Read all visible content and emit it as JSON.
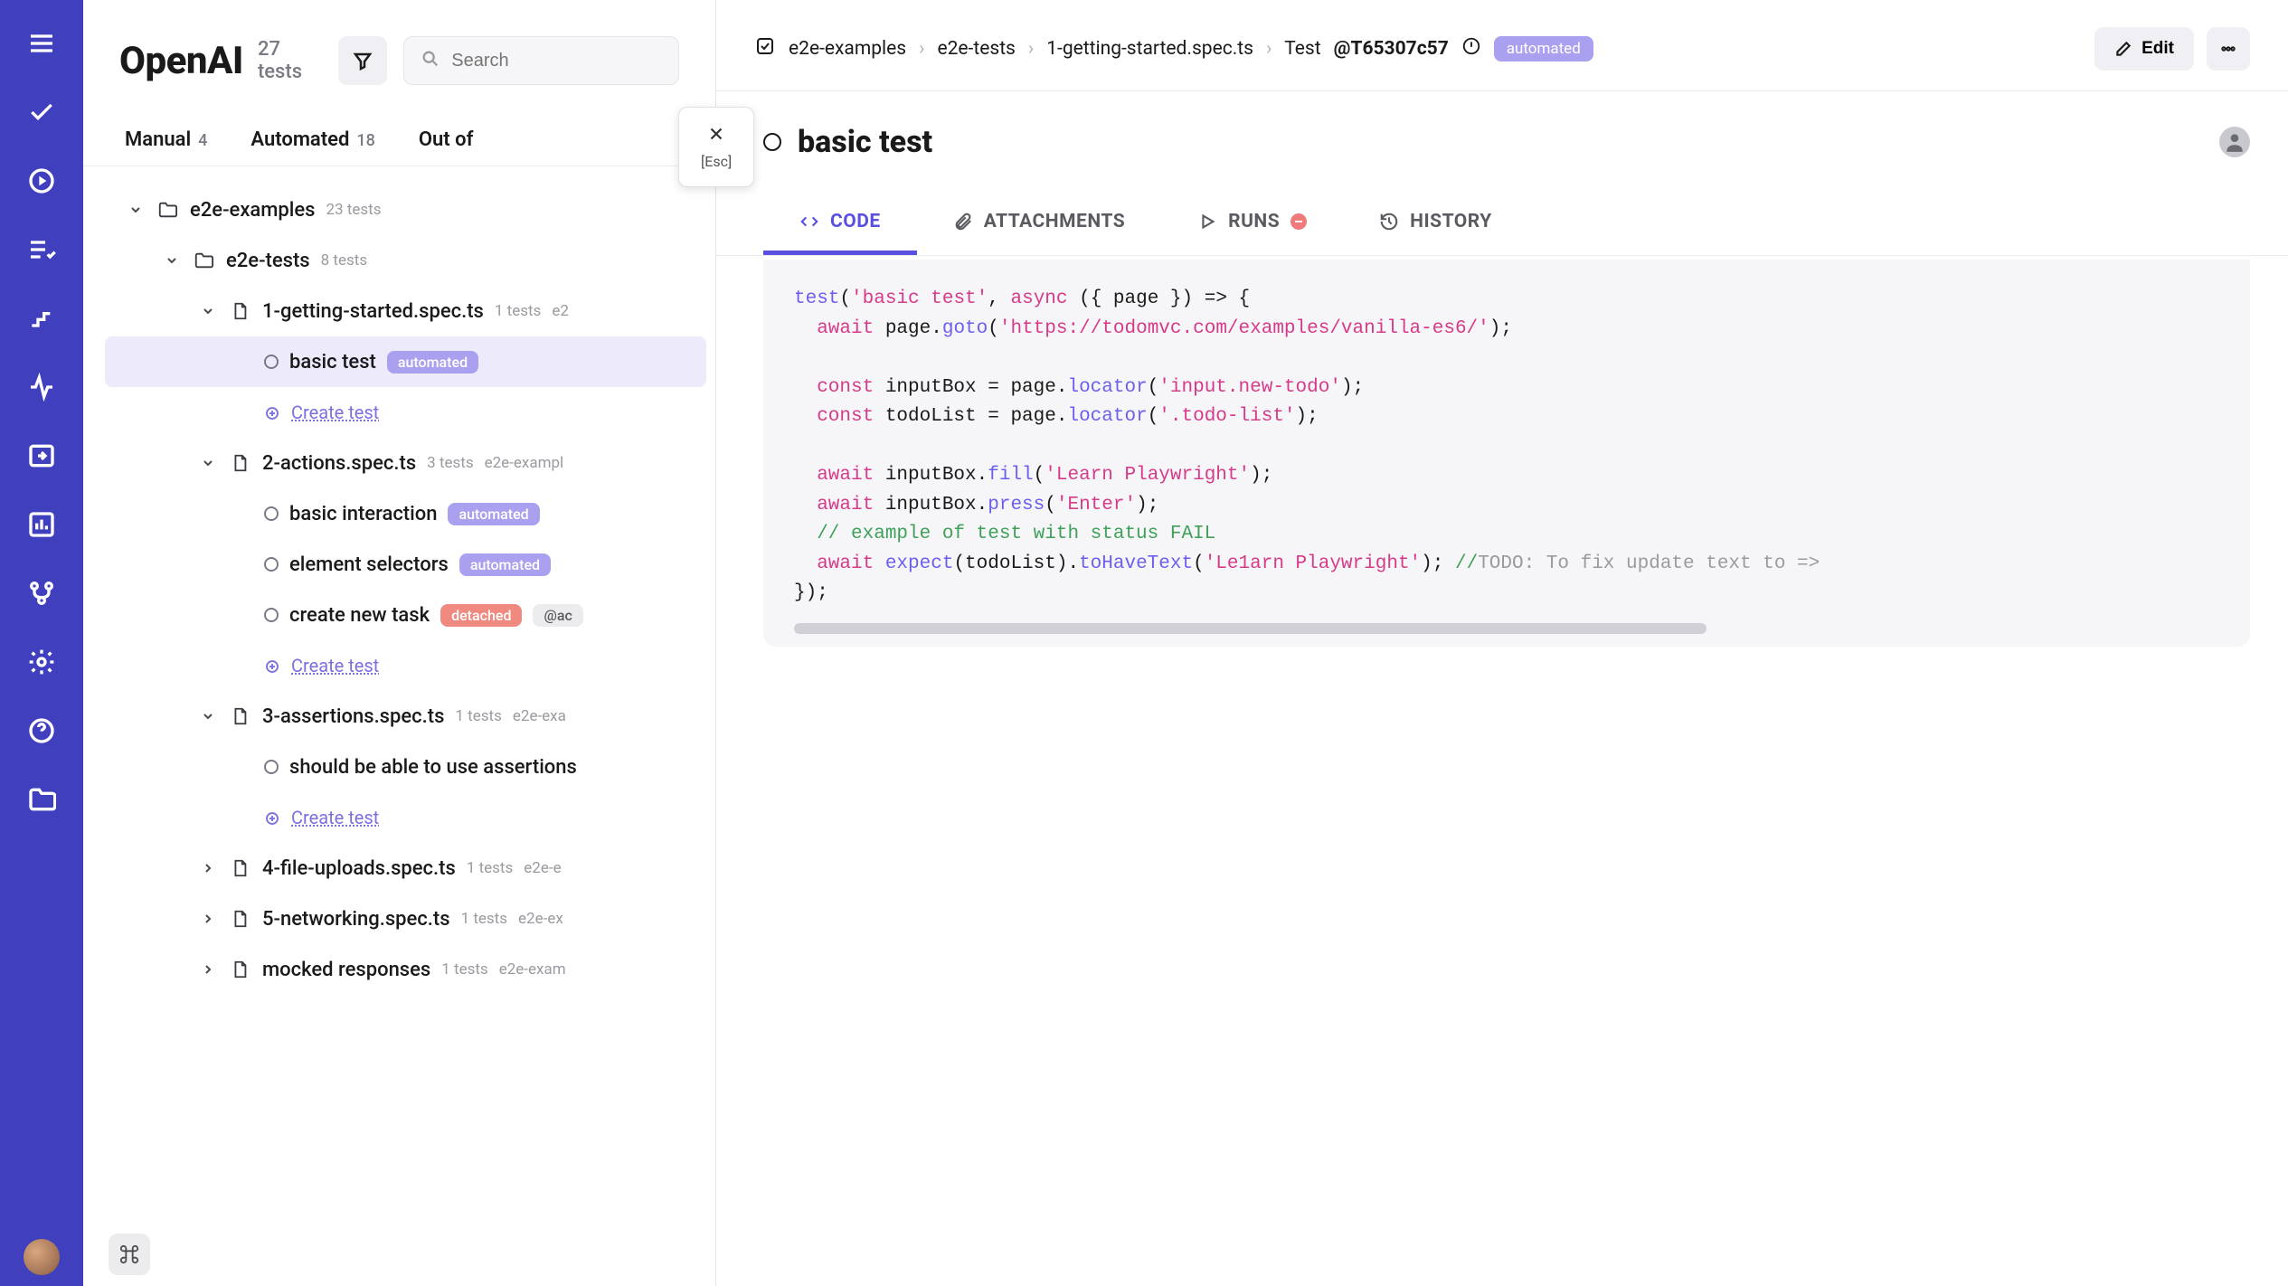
{
  "nav": {
    "items": [
      "menu",
      "check",
      "play",
      "list-check",
      "steps",
      "activity",
      "import",
      "bar-chart",
      "branch",
      "gear",
      "help",
      "folder"
    ]
  },
  "left": {
    "title": "OpenAI",
    "count_label": "27 tests",
    "search_placeholder": "Search",
    "esc_label": "[Esc]",
    "tabs": [
      {
        "label": "Manual",
        "count": "4"
      },
      {
        "label": "Automated",
        "count": "18"
      },
      {
        "label": "Out of",
        "count": ""
      }
    ],
    "tree": [
      {
        "type": "folder",
        "name": "e2e-examples",
        "meta": "23 tests",
        "indent": 0,
        "expanded": true
      },
      {
        "type": "folder",
        "name": "e2e-tests",
        "meta": "8 tests",
        "indent": 1,
        "expanded": true
      },
      {
        "type": "file",
        "name": "1-getting-started.spec.ts",
        "meta": "1 tests",
        "trail": "e2",
        "indent": 2,
        "expanded": true
      },
      {
        "type": "test",
        "name": "basic test",
        "badge": "automated",
        "indent": 3,
        "selected": true
      },
      {
        "type": "create",
        "label": "Create test",
        "indent": 3
      },
      {
        "type": "file",
        "name": "2-actions.spec.ts",
        "meta": "3 tests",
        "trail": "e2e-exampl",
        "indent": 2,
        "expanded": true
      },
      {
        "type": "test",
        "name": "basic interaction",
        "badge": "automated",
        "indent": 3
      },
      {
        "type": "test",
        "name": "element selectors",
        "badge": "automated",
        "indent": 3
      },
      {
        "type": "test",
        "name": "create new task",
        "badge": "detached",
        "trail": "@ac",
        "indent": 3
      },
      {
        "type": "create",
        "label": "Create test",
        "indent": 3
      },
      {
        "type": "file",
        "name": "3-assertions.spec.ts",
        "meta": "1 tests",
        "trail": "e2e-exa",
        "indent": 2,
        "expanded": true
      },
      {
        "type": "test",
        "name": "should be able to use assertions",
        "indent": 3
      },
      {
        "type": "create",
        "label": "Create test",
        "indent": 3
      },
      {
        "type": "file",
        "name": "4-file-uploads.spec.ts",
        "meta": "1 tests",
        "trail": "e2e-e",
        "indent": 2,
        "expanded": false
      },
      {
        "type": "file",
        "name": "5-networking.spec.ts",
        "meta": "1 tests",
        "trail": "e2e-ex",
        "indent": 2,
        "expanded": false
      },
      {
        "type": "file",
        "name": "mocked responses",
        "meta": "1 tests",
        "trail": "e2e-exam",
        "indent": 2,
        "expanded": false
      }
    ]
  },
  "right": {
    "breadcrumb": [
      "e2e-examples",
      "e2e-tests",
      "1-getting-started.spec.ts"
    ],
    "bc_test_label": "Test",
    "bc_test_id": "@T65307c57",
    "badge": "automated",
    "edit_label": "Edit",
    "title": "basic test",
    "tabs": [
      {
        "key": "code",
        "label": "CODE",
        "icon": "code",
        "active": true
      },
      {
        "key": "attachments",
        "label": "ATTACHMENTS",
        "icon": "paperclip"
      },
      {
        "key": "runs",
        "label": "RUNS",
        "icon": "play",
        "dot": true
      },
      {
        "key": "history",
        "label": "HISTORY",
        "icon": "history"
      }
    ],
    "code": {
      "l1_a": "test",
      "l1_b": "(",
      "l1_c": "'basic test'",
      "l1_d": ", ",
      "l1_e": "async",
      "l1_f": " ({ page }) => {",
      "l2_a": "  await",
      "l2_b": " page.",
      "l2_c": "goto",
      "l2_d": "(",
      "l2_e": "'https://todomvc.com/examples/vanilla-es6/'",
      "l2_f": ");",
      "l3": "",
      "l4_a": "  const",
      "l4_b": " inputBox = page.",
      "l4_c": "locator",
      "l4_d": "(",
      "l4_e": "'input.new-todo'",
      "l4_f": ");",
      "l5_a": "  const",
      "l5_b": " todoList = page.",
      "l5_c": "locator",
      "l5_d": "(",
      "l5_e": "'.todo-list'",
      "l5_f": ");",
      "l6": "",
      "l7_a": "  await",
      "l7_b": " inputBox.",
      "l7_c": "fill",
      "l7_d": "(",
      "l7_e": "'Learn Playwright'",
      "l7_f": ");",
      "l8_a": "  await",
      "l8_b": " inputBox.",
      "l8_c": "press",
      "l8_d": "(",
      "l8_e": "'Enter'",
      "l8_f": ");",
      "l9": "  // example of test with status FAIL",
      "l10_a": "  await",
      "l10_b": " expect",
      "l10_c": "(todoList).",
      "l10_d": "toHaveText",
      "l10_e": "(",
      "l10_f": "'Le1arn Playwright'",
      "l10_g": "); ",
      "l10_h": "//",
      "l10_i": "TODO: To fix update text to =>",
      "l11": "});"
    }
  }
}
